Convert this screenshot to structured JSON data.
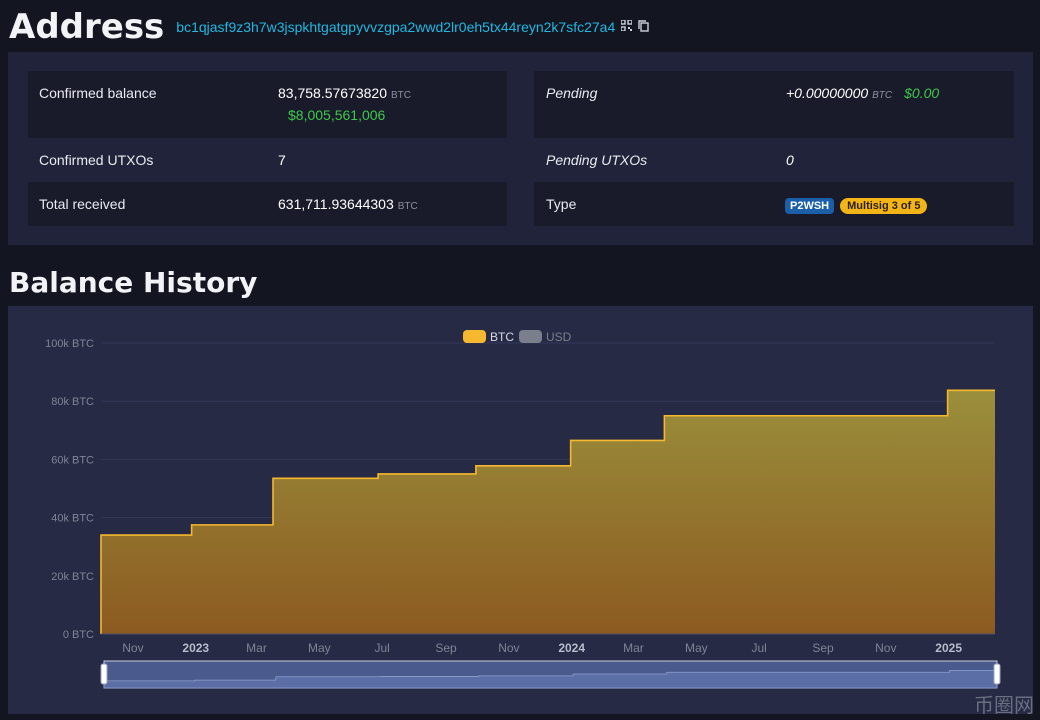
{
  "header": {
    "title": "Address",
    "address": "bc1qjasf9z3h7w3jspkhtgatgpyvvzgpa2wwd2lr0eh5tx44reyn2k7sfc27a4",
    "qr_icon": "qr-code-icon",
    "copy_icon": "copy-icon"
  },
  "summary": {
    "confirmed_balance_label": "Confirmed balance",
    "confirmed_balance_value": "83,758.57673820",
    "confirmed_balance_unit": "BTC",
    "confirmed_balance_usd": "$8,005,561,006",
    "confirmed_utxos_label": "Confirmed UTXOs",
    "confirmed_utxos_value": "7",
    "total_received_label": "Total received",
    "total_received_value": "631,711.93644303",
    "total_received_unit": "BTC",
    "pending_label": "Pending",
    "pending_value": "+0.00000000",
    "pending_unit": "BTC",
    "pending_usd": "$0.00",
    "pending_utxos_label": "Pending UTXOs",
    "pending_utxos_value": "0",
    "type_label": "Type",
    "type_badge": "P2WSH",
    "multisig_badge": "Multisig 3 of 5"
  },
  "section": {
    "balance_history_title": "Balance History"
  },
  "watermark": "币圈网",
  "colors": {
    "accent_cyan": "#22b8e0",
    "series_btc": "#f5b82e",
    "series_usd": "#7b7f8c",
    "positive_green": "#3ec84a"
  },
  "chart_data": {
    "type": "area",
    "step": true,
    "legend": [
      "BTC",
      "USD"
    ],
    "legend_active": "BTC",
    "legend_position": "top-center",
    "ylim": [
      0,
      100000
    ],
    "y_ticks": [
      0,
      20000,
      40000,
      60000,
      80000,
      100000
    ],
    "y_tick_labels": [
      "0 BTC",
      "20k BTC",
      "40k BTC",
      "60k BTC",
      "80k BTC",
      "100k BTC"
    ],
    "x_tick_labels": [
      "Nov",
      "2023",
      "Mar",
      "May",
      "Jul",
      "Sep",
      "Nov",
      "2024",
      "Mar",
      "May",
      "Jul",
      "Sep",
      "Nov",
      "2025"
    ],
    "x_bold_labels": [
      "2023",
      "2024",
      "2025"
    ],
    "x_start": "2022-10-01",
    "x_end": "2025-02-15",
    "x_tick_dates": [
      "2022-11-01",
      "2023-01-01",
      "2023-03-01",
      "2023-05-01",
      "2023-07-01",
      "2023-09-01",
      "2023-11-01",
      "2024-01-01",
      "2024-03-01",
      "2024-05-01",
      "2024-07-01",
      "2024-09-01",
      "2024-11-01",
      "2025-01-01"
    ],
    "series": [
      {
        "name": "BTC",
        "points": [
          {
            "x": "2022-10-01",
            "y": 34000
          },
          {
            "x": "2022-12-28",
            "y": 37500
          },
          {
            "x": "2023-03-17",
            "y": 53500
          },
          {
            "x": "2023-06-27",
            "y": 55000
          },
          {
            "x": "2023-09-30",
            "y": 57800
          },
          {
            "x": "2023-12-31",
            "y": 66500
          },
          {
            "x": "2024-03-31",
            "y": 75000
          },
          {
            "x": "2024-12-31",
            "y": 83758.58
          },
          {
            "x": "2025-02-15",
            "y": 83758.58
          }
        ]
      }
    ],
    "range_selector": true
  }
}
